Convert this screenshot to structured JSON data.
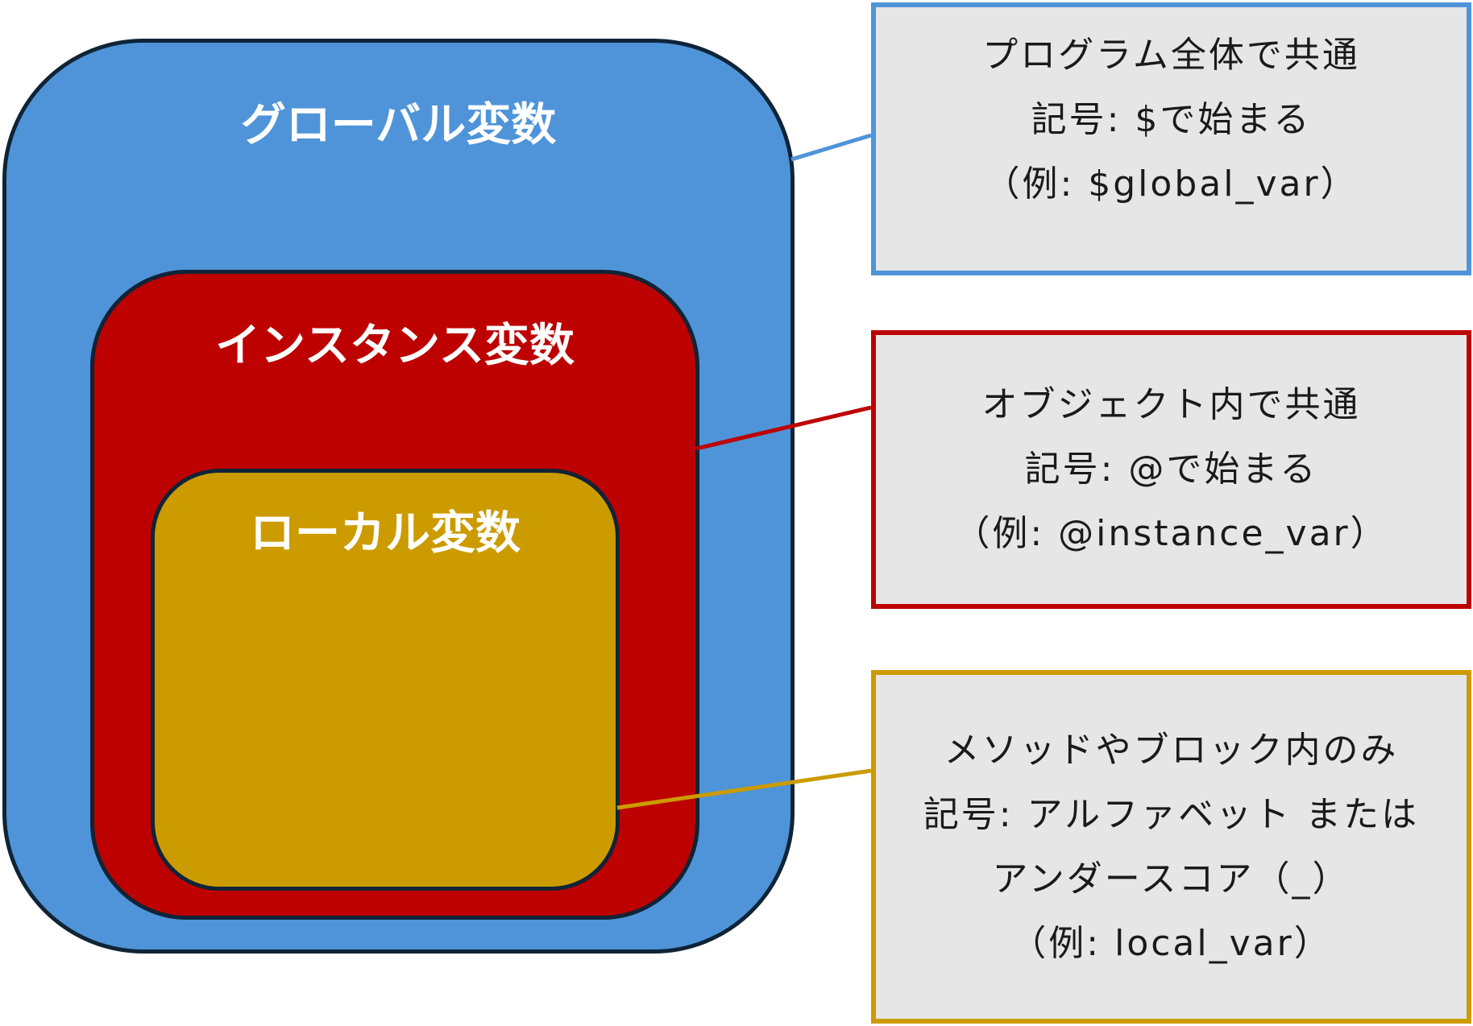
{
  "colors": {
    "global": "#4f94d8",
    "instance": "#bd0000",
    "local": "#cc9b00",
    "outline": "#0f2436",
    "note_background": "#e6e6e6"
  },
  "scopes": {
    "global": {
      "label": "グローバル変数"
    },
    "instance": {
      "label": "インスタンス変数"
    },
    "local": {
      "label": "ローカル変数"
    }
  },
  "notes": {
    "global": {
      "lines": [
        "プログラム全体で共通",
        "記号: $で始まる",
        "（例: $global_var）"
      ]
    },
    "instance": {
      "lines": [
        "オブジェクト内で共通",
        "記号: @で始まる",
        "（例: @instance_var）"
      ]
    },
    "local": {
      "lines": [
        "メソッドやブロック内のみ",
        "記号: アルファベット または",
        "アンダースコア（_）",
        "（例: local_var）"
      ]
    }
  }
}
